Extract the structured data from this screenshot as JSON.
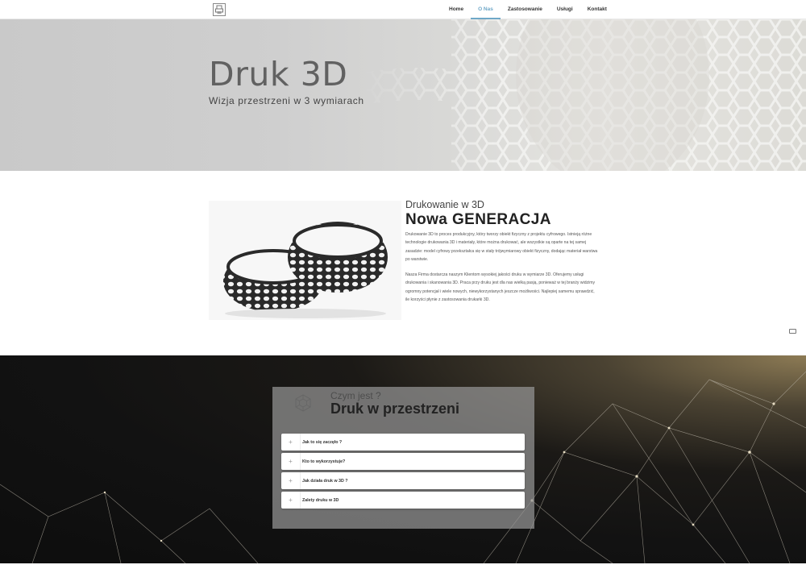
{
  "nav": {
    "logo_icon": "printer-logo-icon",
    "items": [
      {
        "label": "Home",
        "active": false
      },
      {
        "label": "O Nas",
        "active": true
      },
      {
        "label": "Zastosowanie",
        "active": false
      },
      {
        "label": "Usługi",
        "active": false
      },
      {
        "label": "Kontakt",
        "active": false
      }
    ],
    "accent": "#6fa8c8"
  },
  "hero": {
    "title": "Druk 3D",
    "subtitle": "Wizja przestrzeni w 3 wymiarach"
  },
  "about": {
    "kicker": "Drukowanie w 3D",
    "title": "Nowa GENERACJA",
    "paragraph1": "Drukowanie 3D to proces produkcyjny, który tworzy obiekt fizyczny z projektu cyfrowego. Istnieją różne technologie drukowania 3D i materiały, które można drukować, ale wszystkie są oparte na tej samej zasadzie: model cyfrowy przekształca się w stały trójwymiarowy obiekt fizyczny, dodając materiał warstwa po warstwie.",
    "paragraph2": "Nasza Firma dostarcza naszym Klientom wysokiej jakości druku w wymiarze 3D. Oferujemy usługi drukowania i skanowania 3D. Praca przy druku jest dla nas wielką pasją, ponieważ w tej branży widzimy ogromny potencjał i wiele nowych, niewykorzystanych jeszcze możliwości. Najlepiej samemu sprawdzić, ile korzyści płynie z zastosowania drukarki 3D.",
    "image_icon": "3d-printed-bracelets-image",
    "chat_icon": "chat-icon"
  },
  "faq_section": {
    "kicker": "Czym jest ?",
    "title": "Druk w przestrzeni",
    "icon": "hexagon-cube-icon",
    "items": [
      {
        "question": "Jak to się zaczęło ?"
      },
      {
        "question": "Kto to wykorzystuje?"
      },
      {
        "question": "Jak działa druk w 3D ?"
      },
      {
        "question": "Zalety druku w 3D"
      }
    ]
  }
}
